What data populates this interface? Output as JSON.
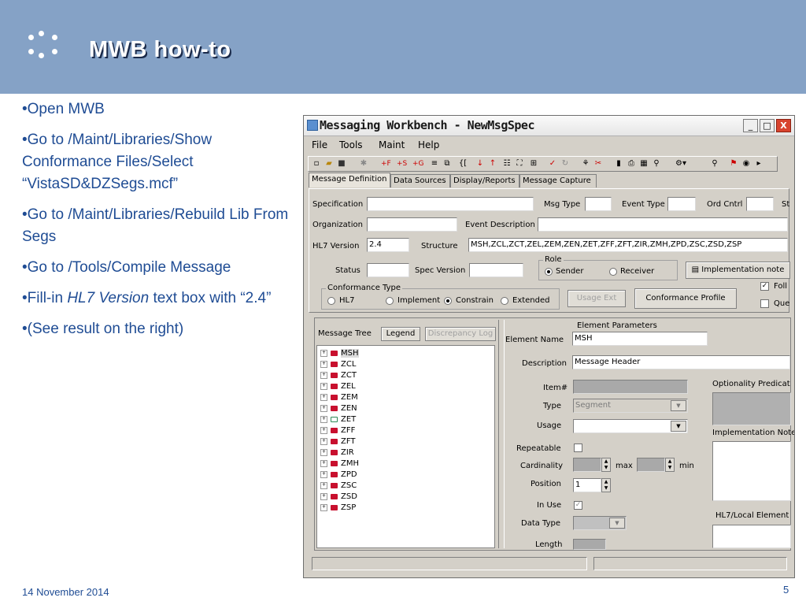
{
  "slide": {
    "title": "MWB how-to",
    "date": "14 November 2014",
    "page": "5",
    "bullets": [
      "•Open MWB",
      "•Go to /Maint/Libraries/Show Conformance Files/Select “VistaSD&DZSegs.mcf”",
      "•Go to /Maint/Libraries/Rebuild Lib From Segs",
      "•Go to /Tools/Compile Message",
      "•Fill-in ",
      "•(See result on the right)"
    ],
    "bullet5_italic": "HL7 Version",
    "bullet5_tail": " text box with “2.4”"
  },
  "window": {
    "title": "Messaging Workbench - NewMsgSpec",
    "min_label": "_",
    "max_label": "□",
    "close_label": "X",
    "menu": [
      "File",
      "Tools",
      "Maint",
      "Help"
    ],
    "tabs": [
      "Message Definition",
      "Data Sources",
      "Display/Reports",
      "Message Capture"
    ],
    "labels": {
      "specification": "Specification",
      "msg_type": "Msg Type",
      "event_type": "Event Type",
      "ord_cntrl": "Ord Cntrl",
      "st": "St",
      "organization": "Organization",
      "event_description": "Event Description",
      "hl7_version": "HL7 Version",
      "structure": "Structure",
      "status": "Status",
      "spec_version": "Spec Version",
      "role": "Role",
      "sender": "Sender",
      "receiver": "Receiver",
      "implementation_note": "Implementation note",
      "conformance_type": "Conformance Type",
      "hl7": "HL7",
      "implement": "Implement",
      "constrain": "Constrain",
      "extended": "Extended",
      "usage_ext": "Usage Ext",
      "conformance_profile": "Conformance Profile",
      "foll": "Foll",
      "que": "Que"
    },
    "values": {
      "hl7_version": "2.4",
      "structure": "MSH,ZCL,ZCT,ZEL,ZEM,ZEN,ZET,ZFF,ZFT,ZIR,ZMH,ZPD,ZSC,ZSD,ZSP"
    },
    "tree": {
      "label": "Message Tree",
      "legend_button": "Legend",
      "discrepancy_button": "Discrepancy Log",
      "items": [
        "MSH",
        "ZCL",
        "ZCT",
        "ZEL",
        "ZEM",
        "ZEN",
        "ZET",
        "ZFF",
        "ZFT",
        "ZIR",
        "ZMH",
        "ZPD",
        "ZSC",
        "ZSD",
        "ZSP"
      ]
    },
    "element": {
      "header": "Element Parameters",
      "element_name_label": "Element Name",
      "element_name": "MSH",
      "description_label": "Description",
      "description": "Message Header",
      "item_label": "Item#",
      "type_label": "Type",
      "type_value": "Segment",
      "usage_label": "Usage",
      "repeatable_label": "Repeatable",
      "cardinality_label": "Cardinality",
      "max_label": "max",
      "min_label": "min",
      "position_label": "Position",
      "position_value": "1",
      "in_use_label": "In Use",
      "data_type_label": "Data Type",
      "length_label": "Length",
      "optionality_label": "Optionality Predicat",
      "impl_notes_label": "Implementation Note",
      "hl7_local_label": "HL7/Local Element"
    }
  }
}
